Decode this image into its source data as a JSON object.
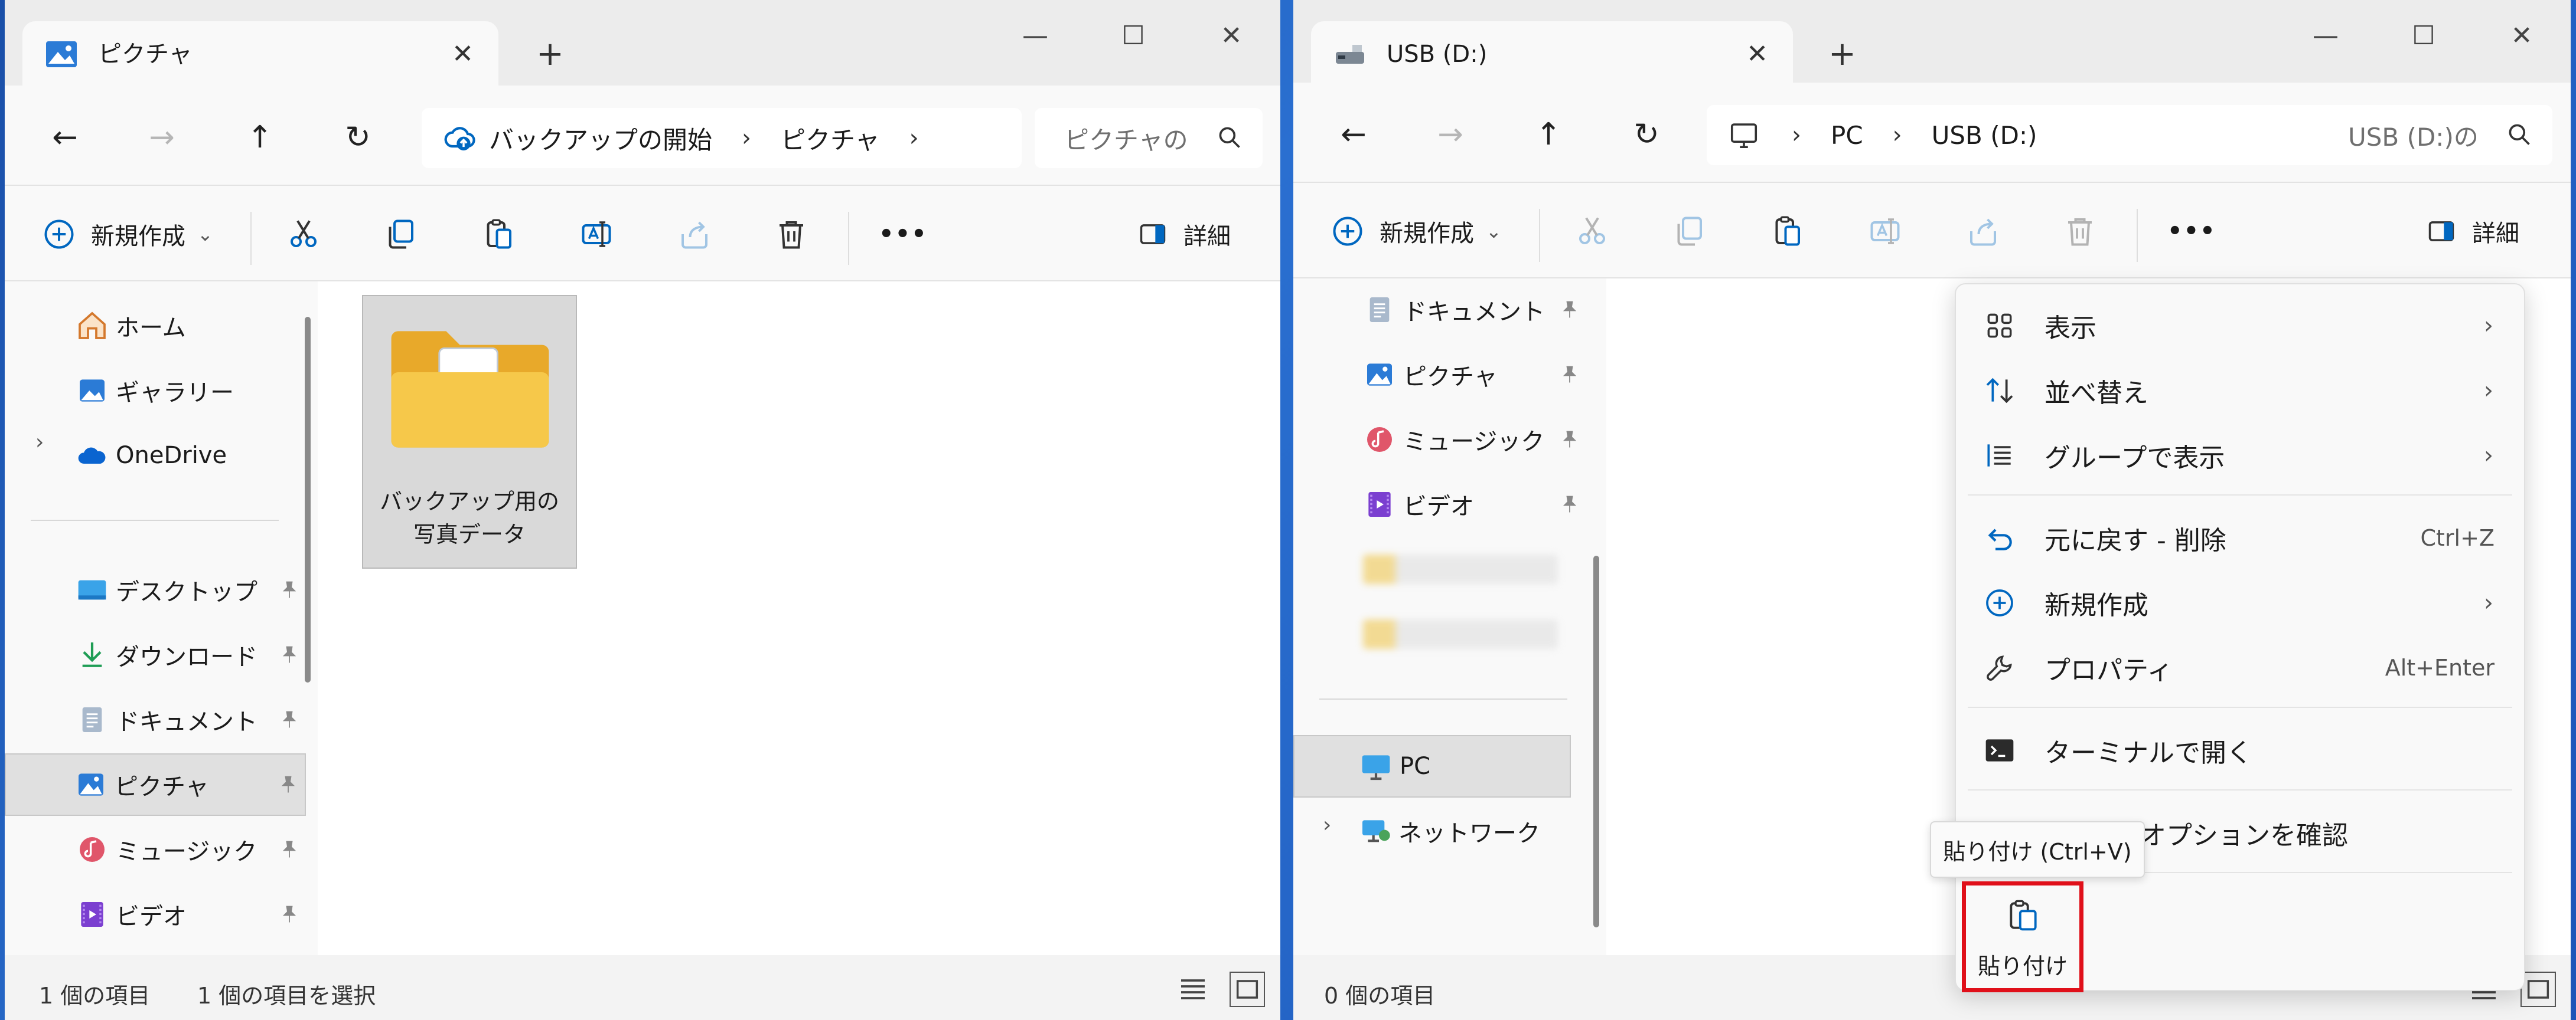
{
  "left": {
    "tab_title": "ピクチャ",
    "tab_close": "✕",
    "tab_new": "+",
    "caption": {
      "min": "—",
      "max": "☐",
      "close": "✕"
    },
    "nav": {
      "back": "←",
      "forward": "→",
      "up": "↑",
      "refresh": "↻"
    },
    "breadcrumb": [
      "バックアップの開始",
      "ピクチャ"
    ],
    "search_placeholder": "ピクチャの",
    "toolbar": {
      "new_label": "新規作成",
      "new_chevron": "⌄",
      "more": "•••",
      "details_label": "詳細"
    },
    "nav_items": {
      "home": "ホーム",
      "gallery": "ギャラリー",
      "onedrive": "OneDrive",
      "desktop": "デスクトップ",
      "downloads": "ダウンロード",
      "documents": "ドキュメント",
      "pictures": "ピクチャ",
      "music": "ミュージック",
      "videos": "ビデオ"
    },
    "expand_glyph": "›",
    "folder_name": "バックアップ用の写真データ",
    "status": {
      "count": "1 個の項目",
      "selected": "1 個の項目を選択"
    }
  },
  "right": {
    "tab_title": "USB (D:)",
    "tab_close": "✕",
    "tab_new": "+",
    "caption": {
      "min": "—",
      "max": "☐",
      "close": "✕"
    },
    "nav": {
      "back": "←",
      "forward": "→",
      "up": "↑",
      "refresh": "↻"
    },
    "breadcrumb": [
      "PC",
      "USB (D:)"
    ],
    "search_placeholder": "USB (D:)の",
    "toolbar": {
      "new_label": "新規作成",
      "new_chevron": "⌄",
      "more": "•••",
      "details_label": "詳細"
    },
    "nav_items": {
      "documents": "ドキュメント",
      "pictures": "ピクチャ",
      "music": "ミュージック",
      "videos": "ビデオ",
      "pc": "PC",
      "network": "ネットワーク"
    },
    "expand_glyph": "›",
    "status": {
      "count": "0 個の項目"
    }
  },
  "context_menu": {
    "view": "表示",
    "sort": "並べ替え",
    "group": "グループで表示",
    "undo": "元に戻す - 削除",
    "undo_shortcut": "Ctrl+Z",
    "new": "新規作成",
    "properties": "プロパティ",
    "properties_shortcut": "Alt+Enter",
    "terminal": "ターミナルで開く",
    "more_options": "オプションを確認",
    "arrow": "›"
  },
  "tooltip": "貼り付け (Ctrl+V)",
  "paste_label": "貼り付け",
  "colors": {
    "accent": "#0067c0",
    "highlight_border": "#e0101a",
    "folder": "#f3c44f"
  }
}
